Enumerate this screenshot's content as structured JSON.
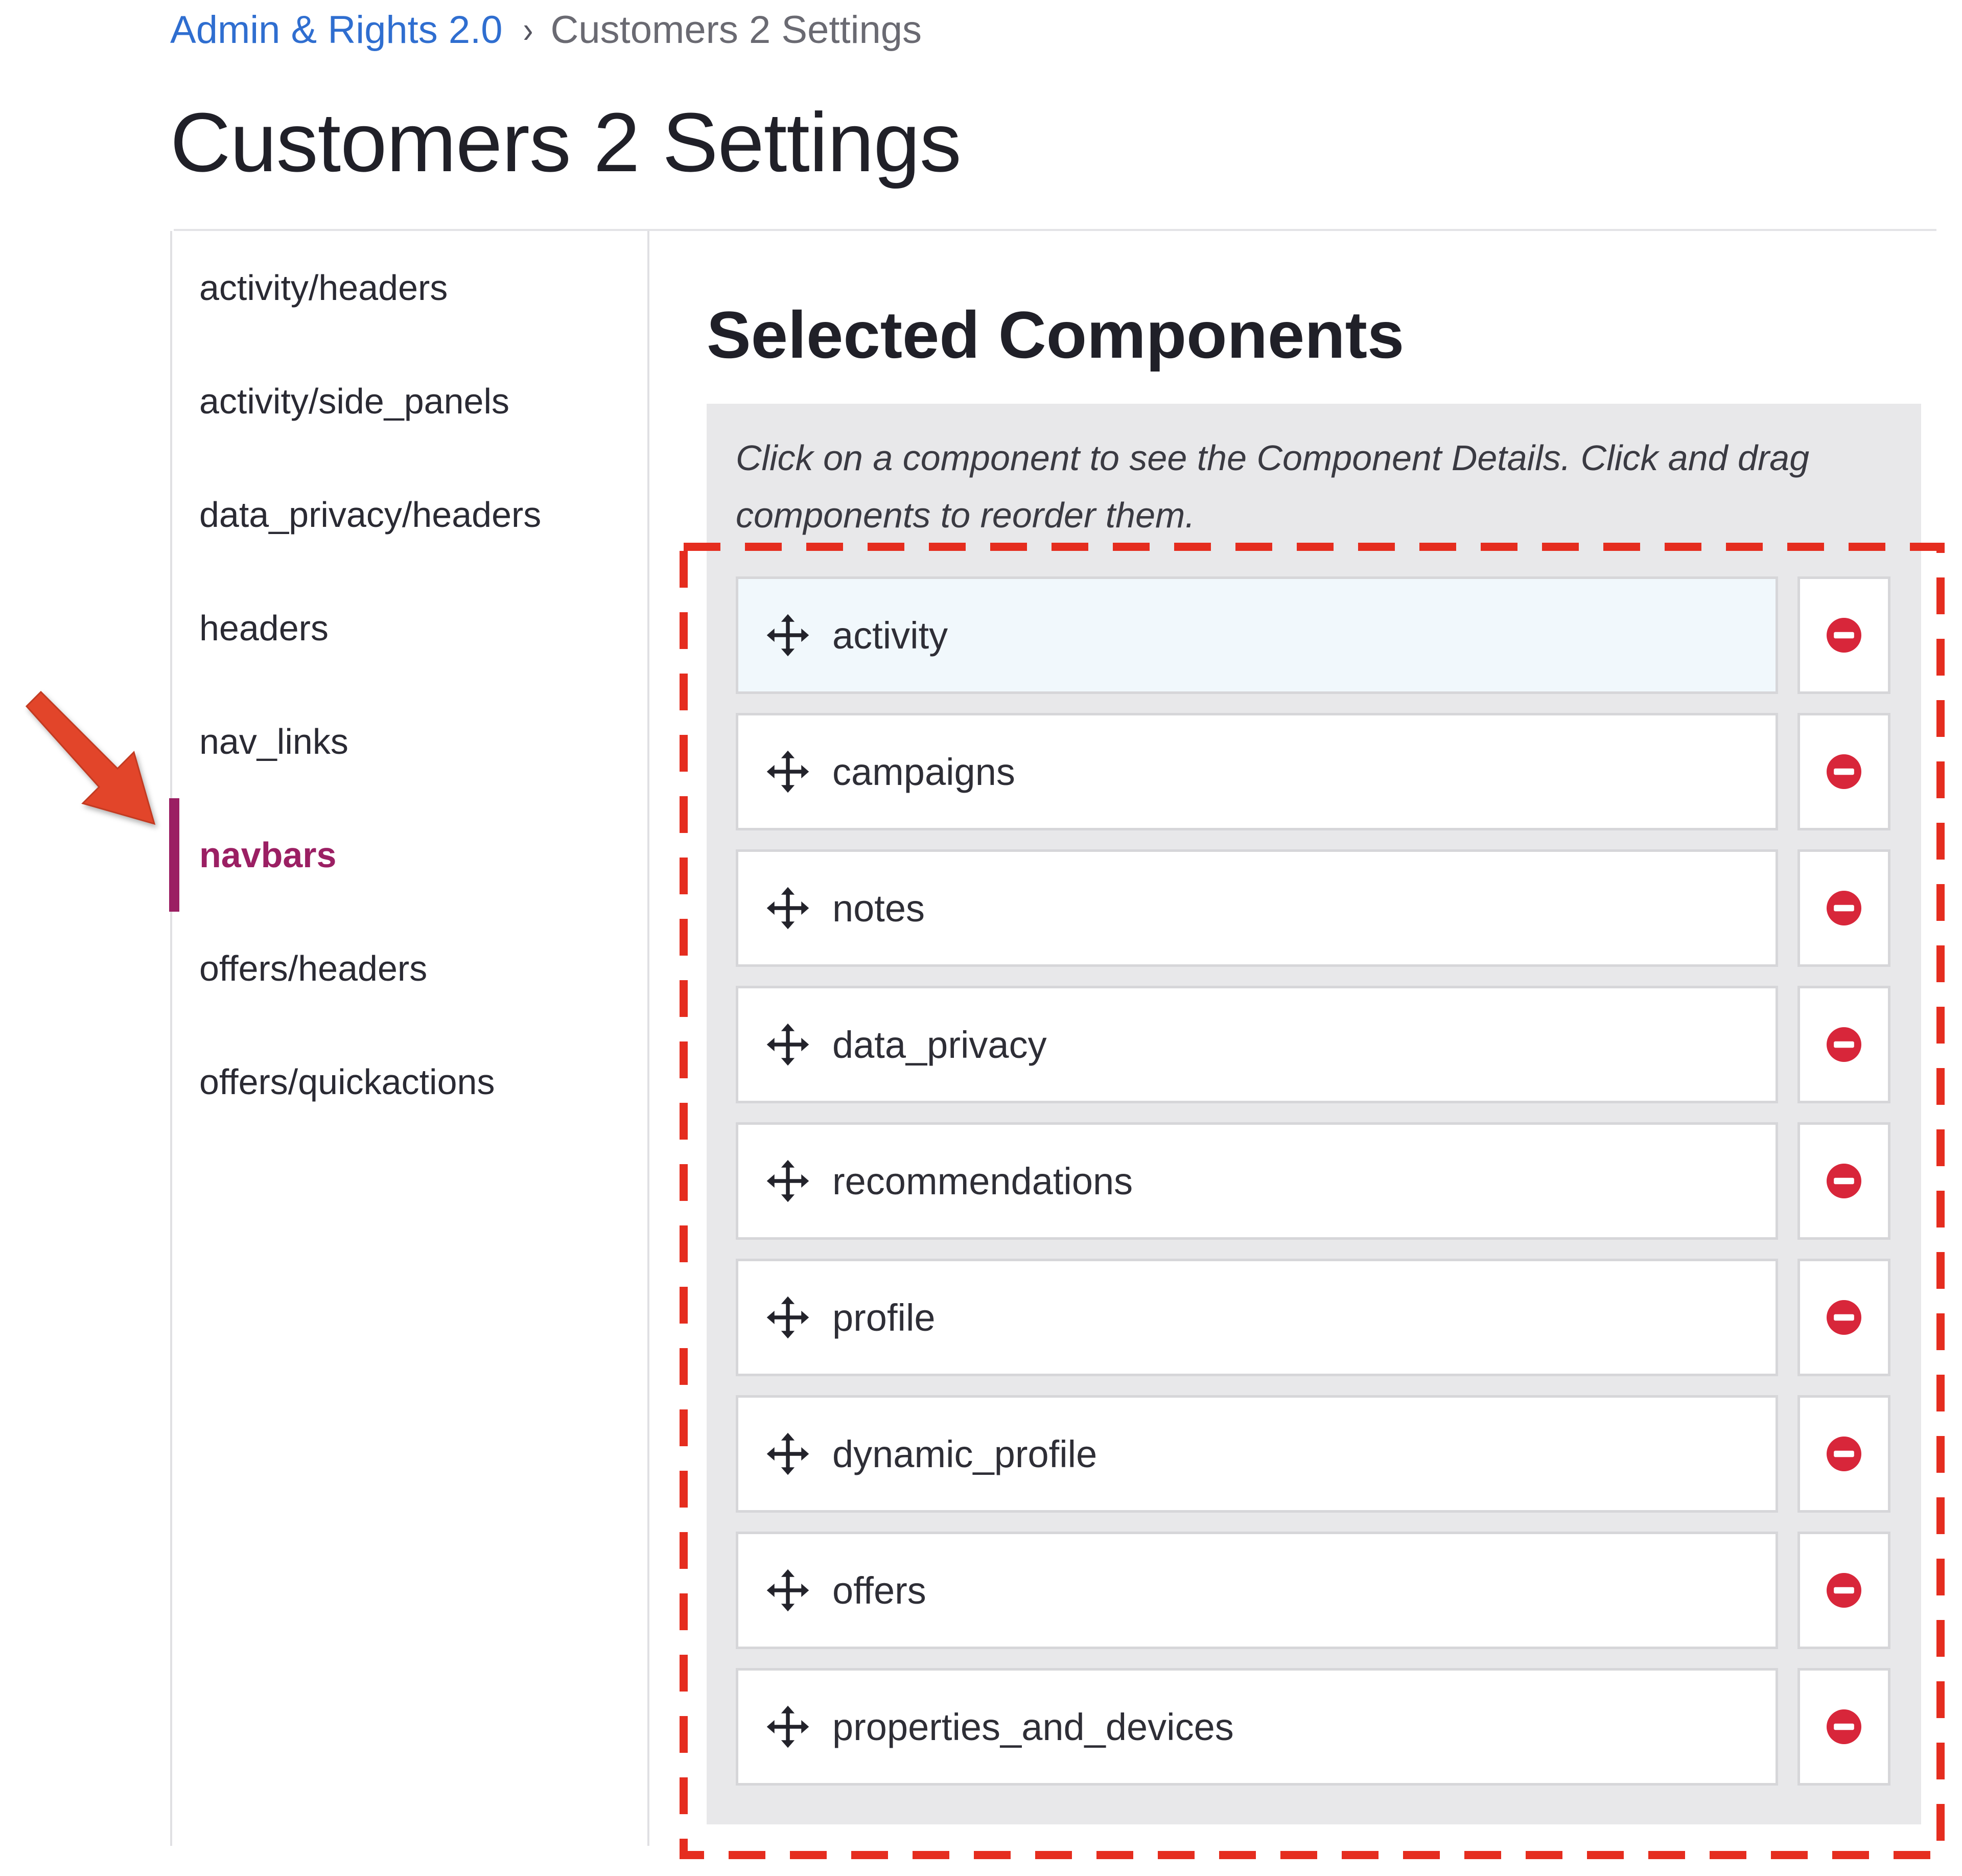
{
  "breadcrumb": {
    "parent": "Admin & Rights 2.0",
    "separator": "›",
    "current": "Customers 2 Settings"
  },
  "page_title": "Customers 2 Settings",
  "sidebar": {
    "items": [
      {
        "label": "activity/headers",
        "active": false
      },
      {
        "label": "activity/side_panels",
        "active": false
      },
      {
        "label": "data_privacy/headers",
        "active": false
      },
      {
        "label": "headers",
        "active": false
      },
      {
        "label": "nav_links",
        "active": false
      },
      {
        "label": "navbars",
        "active": true
      },
      {
        "label": "offers/headers",
        "active": false
      },
      {
        "label": "offers/quickactions",
        "active": false
      }
    ]
  },
  "main": {
    "section_title": "Selected Components",
    "help_text": "Click on a component to see the Component Details. Click and drag components to reorder them.",
    "components": [
      {
        "label": "activity",
        "highlighted": true
      },
      {
        "label": "campaigns",
        "highlighted": false
      },
      {
        "label": "notes",
        "highlighted": false
      },
      {
        "label": "data_privacy",
        "highlighted": false
      },
      {
        "label": "recommendations",
        "highlighted": false
      },
      {
        "label": "profile",
        "highlighted": false
      },
      {
        "label": "dynamic_profile",
        "highlighted": false
      },
      {
        "label": "offers",
        "highlighted": false
      },
      {
        "label": "properties_and_devices",
        "highlighted": false
      }
    ]
  },
  "icons": {
    "drag_handle": "move-icon",
    "remove": "remove-icon",
    "annotation": "arrow-icon"
  },
  "colors": {
    "link": "#2f6ed0",
    "active_item": "#9b1f63",
    "remove_icon": "#d8263a",
    "annotation": "#e2452b",
    "panel_bg": "#e8e8ea",
    "highlight_row": "#f1f8fc"
  }
}
